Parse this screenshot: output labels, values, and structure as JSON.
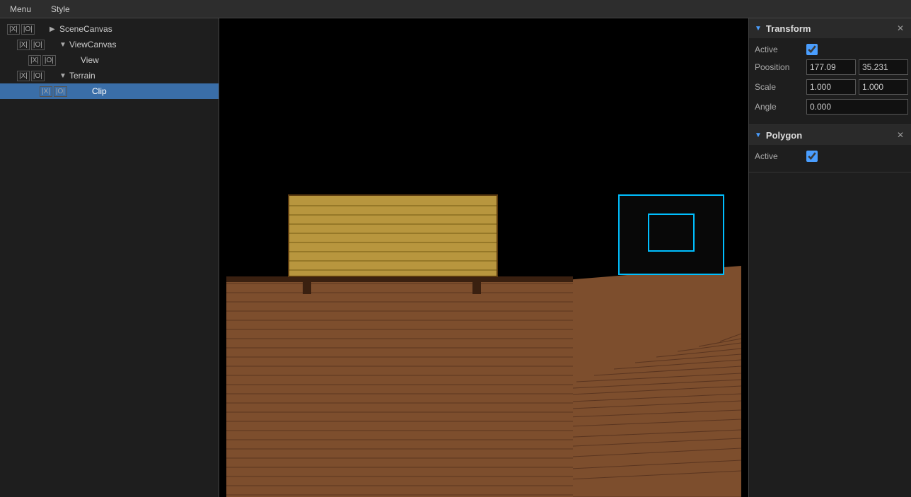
{
  "menubar": {
    "items": [
      "Menu",
      "Style"
    ]
  },
  "sceneTree": {
    "rows": [
      {
        "id": "scene-canvas",
        "indent": 1,
        "xBtn": "|X|",
        "oBtn": "|O|",
        "arrow": "▶",
        "label": "SceneCanvas",
        "selected": false
      },
      {
        "id": "view-canvas",
        "indent": 2,
        "xBtn": "|X|",
        "oBtn": "|O|",
        "arrow": "▼",
        "label": "ViewCanvas",
        "selected": false
      },
      {
        "id": "view",
        "indent": 3,
        "xBtn": "|X|",
        "oBtn": "|O|",
        "arrow": "",
        "label": "View",
        "selected": false
      },
      {
        "id": "terrain",
        "indent": 2,
        "xBtn": "|X|",
        "oBtn": "|O|",
        "arrow": "▼",
        "label": "Terrain",
        "selected": false
      },
      {
        "id": "clip",
        "indent": 3,
        "xBtn": "|X|",
        "oBtn": "|O|",
        "arrow": "",
        "label": "Clip",
        "selected": true
      }
    ]
  },
  "transform": {
    "header": "Transform",
    "active_label": "Active",
    "active_checked": true,
    "position_label": "Poosition",
    "position_x": "177.09",
    "position_y": "35.231",
    "scale_label": "Scale",
    "scale_x": "1.000",
    "scale_y": "1.000",
    "angle_label": "Angle",
    "angle_value": "0.000"
  },
  "polygon": {
    "header": "Polygon",
    "active_label": "Active",
    "active_checked": true
  },
  "viewport": {
    "background": "#000000"
  }
}
